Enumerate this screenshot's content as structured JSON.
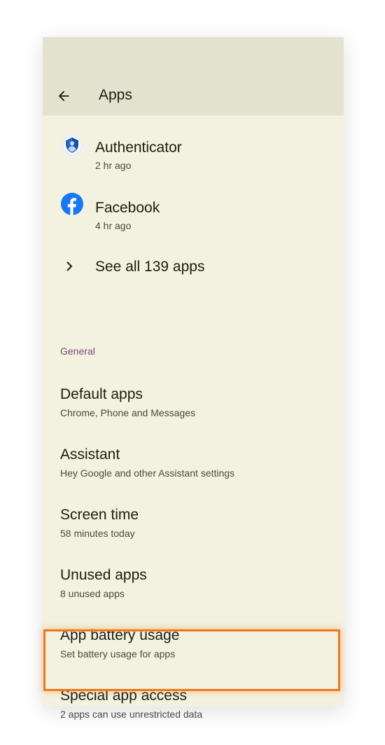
{
  "header": {
    "title": "Apps",
    "back_icon": "arrow-left-icon"
  },
  "recent_apps": [
    {
      "name": "Authenticator",
      "time": "2 hr ago",
      "icon": "authenticator-icon"
    },
    {
      "name": "Facebook",
      "time": "4 hr ago",
      "icon": "facebook-icon"
    }
  ],
  "see_all": {
    "label": "See all 139 apps",
    "icon": "chevron-right-icon"
  },
  "general": {
    "header": "General",
    "items": [
      {
        "title": "Default apps",
        "subtitle": "Chrome, Phone and Messages"
      },
      {
        "title": "Assistant",
        "subtitle": "Hey Google and other Assistant settings"
      },
      {
        "title": "Screen time",
        "subtitle": "58 minutes today"
      },
      {
        "title": "Unused apps",
        "subtitle": "8 unused apps"
      },
      {
        "title": "App battery usage",
        "subtitle": "Set battery usage for apps"
      },
      {
        "title": "Special app access",
        "subtitle": "2 apps can use unrestricted data"
      }
    ]
  },
  "colors": {
    "background": "#f3f1df",
    "appbar": "#e3e2cf",
    "section_header": "#7b4a78",
    "highlight": "#ef7818",
    "facebook_blue": "#1877f2"
  }
}
